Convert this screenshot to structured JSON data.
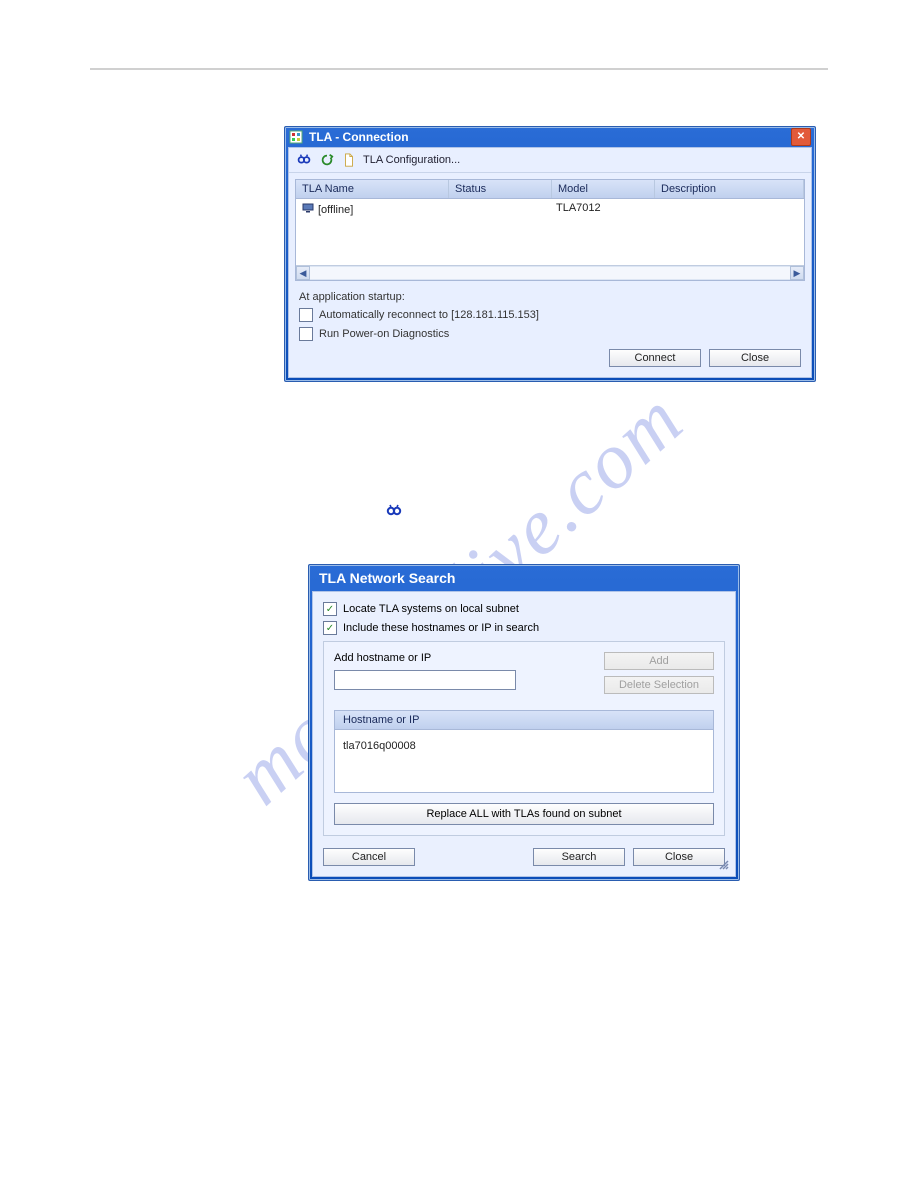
{
  "watermark": "manualslive.com",
  "connection_window": {
    "title": "TLA - Connection",
    "toolbar": {
      "config_label": "TLA Configuration..."
    },
    "columns": {
      "name": "TLA Name",
      "status": "Status",
      "model": "Model",
      "description": "Description"
    },
    "rows": [
      {
        "name": "[offline]",
        "status": "",
        "model": "TLA7012",
        "description": ""
      }
    ],
    "startup_heading": "At application startup:",
    "auto_reconnect_label": "Automatically reconnect to [128.181.115.153]",
    "run_power_label": "Run Power-on Diagnostics",
    "connect_label": "Connect",
    "close_label": "Close"
  },
  "search_window": {
    "title": "TLA Network Search",
    "locate_label": "Locate TLA systems on local subnet",
    "include_label": "Include these hostnames or IP in search",
    "add_heading": "Add hostname or IP",
    "add_btn": "Add",
    "delete_btn": "Delete Selection",
    "list_header": "Hostname or IP",
    "items": [
      "tla7016q00008"
    ],
    "replace_btn": "Replace ALL with TLAs found on subnet",
    "cancel_btn": "Cancel",
    "search_btn": "Search",
    "close_btn": "Close"
  }
}
